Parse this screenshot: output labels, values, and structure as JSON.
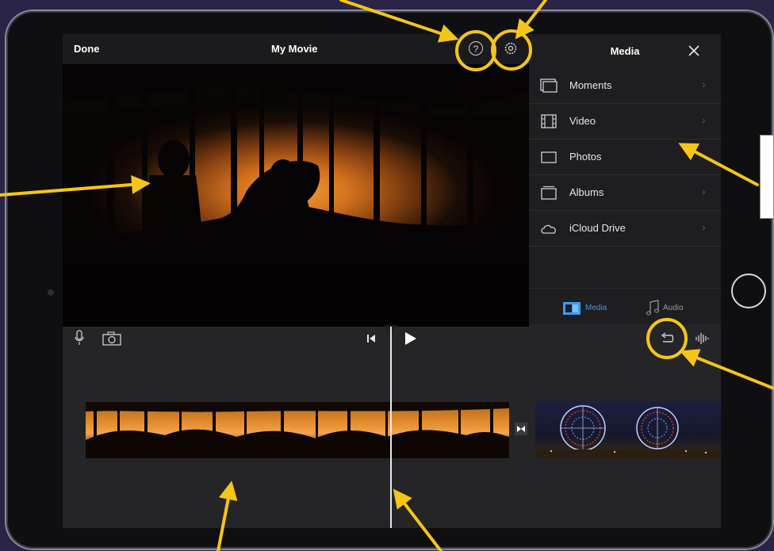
{
  "window": {
    "done_label": "Done",
    "title": "My Movie"
  },
  "toolbar": {
    "help_icon": "?",
    "settings_icon": "gear-icon"
  },
  "media_panel": {
    "title": "Media",
    "items": [
      {
        "label": "Moments",
        "icon": "moments-icon",
        "chevron": "›"
      },
      {
        "label": "Video",
        "icon": "film-icon",
        "chevron": "›"
      },
      {
        "label": "Photos",
        "icon": "photo-icon",
        "chevron": ""
      },
      {
        "label": "Albums",
        "icon": "album-icon",
        "chevron": "›"
      },
      {
        "label": "iCloud Drive",
        "icon": "cloud-icon",
        "chevron": "›"
      }
    ],
    "tabs": [
      {
        "label": "Media",
        "selected": true
      },
      {
        "label": "Audio",
        "selected": false
      }
    ]
  },
  "colors": {
    "accent": "#3c9bf0",
    "annotation": "#f5c518",
    "background": "#1e1e20"
  }
}
